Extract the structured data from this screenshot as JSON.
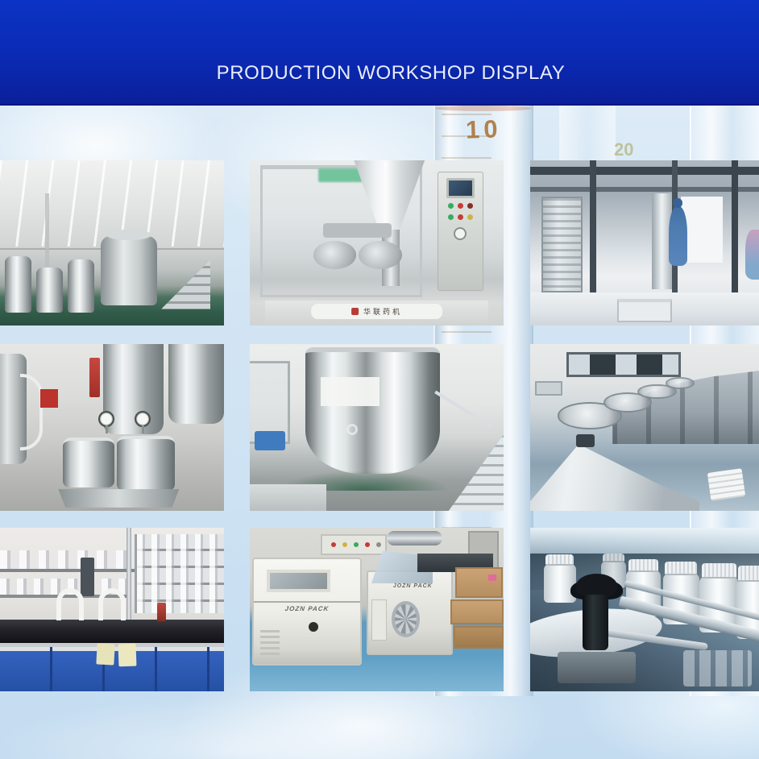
{
  "header": {
    "title": "PRODUCTION WORKSHOP DISPLAY"
  },
  "background": {
    "cylinder_scale_primary": "10",
    "cylinder_scale_secondary": "20"
  },
  "colors": {
    "banner_blue_top": "#0c33c4",
    "banner_blue_bottom": "#0b1f9a",
    "title_text": "#e9edfa",
    "page_background": "#d3e5f4",
    "lab_cabinet_blue": "#2858b8",
    "workshop_floor_green": "#2e5c49",
    "packing_floor_blue": "#5aa0c9"
  },
  "gallery": {
    "photos": [
      {
        "id": "cleanroom-workshop",
        "desc": "Clean room production workshop with stainless steel mixing vessels, ceiling lights and green epoxy floor"
      },
      {
        "id": "tube-filling-machine",
        "desc": "Stainless automatic tube filling machine with film-wrapped hopper and push-button control panel",
        "base_label": "华联药机"
      },
      {
        "id": "packaging-line-workers",
        "desc": "Packaging line steel framework with technicians in blue cleanroom suits"
      },
      {
        "id": "stainless-storage-tanks",
        "desc": "Stainless steel storage tanks, mixing kettles and pressure gauges"
      },
      {
        "id": "vacuum-mixing-tank",
        "desc": "Polished vacuum emulsifying mixer tank with access stairs"
      },
      {
        "id": "pillow-pack-line",
        "desc": "Row of pillow packaging machines with rotary feed pans and discharge cone"
      },
      {
        "id": "laboratory-bench",
        "desc": "Quality-control laboratory bench with glassware shelves, black counter and blue cabinets"
      },
      {
        "id": "shrink-wrap-machines",
        "desc": "White shrink wrapping machines beside stacked cartons on blue floor",
        "brand_left": "JOZN PACK",
        "brand_center": "JOZN PACK"
      },
      {
        "id": "bottle-capping-line",
        "desc": "Close-up of white plastic bottles on a capping conveyor with clamp knob"
      }
    ]
  }
}
